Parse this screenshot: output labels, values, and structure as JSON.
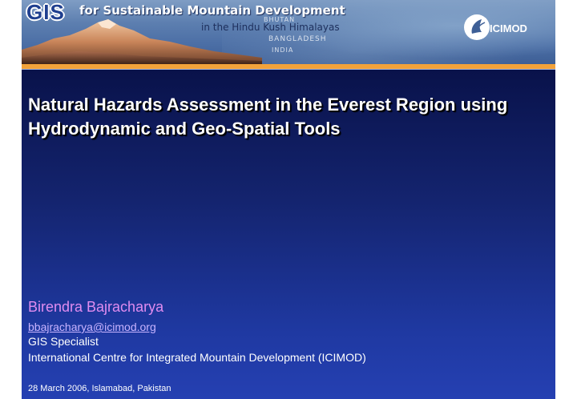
{
  "banner": {
    "logo_text": "GIS",
    "title": "for Sustainable Mountain Development",
    "subtitle": "in the Hindu Kush Himalayas",
    "map_labels": [
      "BHUTAN",
      "BANGLADESH",
      "INDIA"
    ],
    "logo_name": "ICIMOD",
    "colors": {
      "logo": "#1f3f8f",
      "accent_bar": "#f2a23a"
    }
  },
  "slide": {
    "title": "Natural Hazards Assessment in the Everest Region using Hydrodynamic and Geo-Spatial Tools",
    "author": {
      "name": "Birendra Bajracharya",
      "email": "bbajracharya@icimod.org",
      "role": "GIS Specialist",
      "organization": "International Centre for Integrated Mountain Development (ICIMOD)"
    },
    "date_place": "28 March 2006, Islamabad, Pakistan",
    "colors": {
      "background_top": "#09124a",
      "background_bottom": "#2540b2",
      "author_name": "#e08cf0"
    }
  }
}
